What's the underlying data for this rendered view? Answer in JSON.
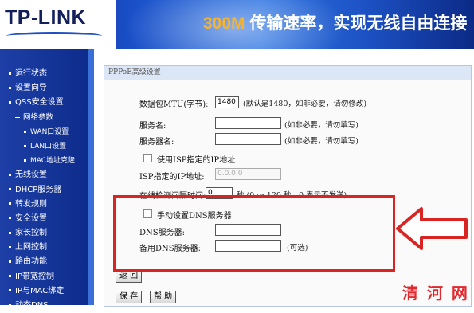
{
  "brand": {
    "logo": "TP-LINK",
    "slogan_speed": "300M",
    "slogan_rest": " 传输速率，实现无线自由连接"
  },
  "sidebar": {
    "items": [
      {
        "label": "运行状态",
        "level": "top"
      },
      {
        "label": "设置向导",
        "level": "top"
      },
      {
        "label": "QSS安全设置",
        "level": "top"
      },
      {
        "label": "网络参数",
        "level": "group"
      },
      {
        "label": "WAN口设置",
        "level": "sub"
      },
      {
        "label": "LAN口设置",
        "level": "sub"
      },
      {
        "label": "MAC地址克隆",
        "level": "sub"
      },
      {
        "label": "无线设置",
        "level": "top"
      },
      {
        "label": "DHCP服务器",
        "level": "top"
      },
      {
        "label": "转发规则",
        "level": "top"
      },
      {
        "label": "安全设置",
        "level": "top"
      },
      {
        "label": "家长控制",
        "level": "top"
      },
      {
        "label": "上网控制",
        "level": "top"
      },
      {
        "label": "路由功能",
        "level": "top"
      },
      {
        "label": "IP带宽控制",
        "level": "top"
      },
      {
        "label": "IP与MAC绑定",
        "level": "top"
      },
      {
        "label": "动态DNS",
        "level": "top"
      }
    ]
  },
  "panel": {
    "title": "PPPoE高级设置",
    "mtu": {
      "label": "数据包MTU(字节):",
      "value": "1480",
      "hint": "(默认是1480，如非必要，请勿修改)"
    },
    "service_name": {
      "label": "服务名:",
      "value": "",
      "hint": "(如非必要，请勿填写)"
    },
    "server_name": {
      "label": "服务器名:",
      "value": "",
      "hint": "(如非必要，请勿填写)"
    },
    "isp_ip": {
      "checkbox_label": "使用ISP指定的IP地址",
      "checked": false,
      "label": "ISP指定的IP地址:",
      "value": "0.0.0.0"
    },
    "idle": {
      "label": "在线检测间隔时间:",
      "value": "0",
      "hint": "秒 (0 ～ 120 秒，0 表示不发送)"
    },
    "manual_dns": {
      "checkbox_label": "手动设置DNS服务器",
      "checked": false
    },
    "dns": {
      "label": "DNS服务器:",
      "value": ""
    },
    "dns2": {
      "label": "备用DNS服务器:",
      "value": "",
      "hint": "(可选)"
    },
    "back_button": "返 回",
    "save_button": "保 存",
    "help_button": "帮 助"
  },
  "watermark": "清 河 网",
  "colors": {
    "highlight": "#d92424",
    "sidebar": "#0c2a8a",
    "banner": "#1a4fc8",
    "slogan_accent": "#f4b431"
  }
}
